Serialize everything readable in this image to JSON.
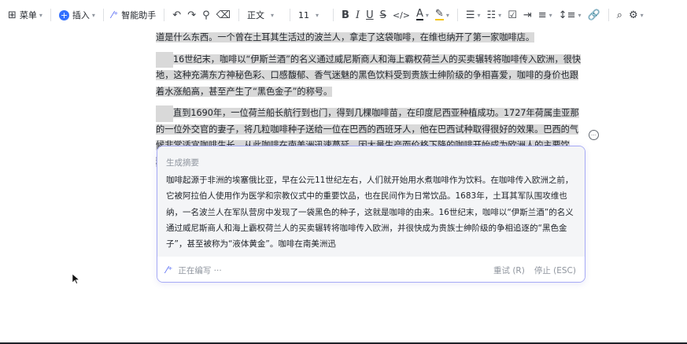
{
  "toolbar": {
    "menu_label": "菜单",
    "insert_label": "插入",
    "assistant_label": "智能助手",
    "style_label": "正文",
    "font_size": "11"
  },
  "doc": {
    "line0": "道是什么东西。一个曾在土耳其生活过的波兰人，拿走了这袋咖啡，在维也纳开了第一家咖啡店。",
    "para1": "16世纪末，咖啡以“伊斯兰酒”的名义通过威尼斯商人和海上霸权荷兰人的买卖辗转将咖啡传入欧洲，很快地，这种充满东方神秘色彩、口感馥郁、香气迷魅的黑色饮料受到贵族士绅阶级的争相喜爱，咖啡的身价也跟着水涨船高，甚至产生了“黑色金子”的称号。",
    "para2": "直到1690年，一位荷兰船长航行到也门，得到几棵咖啡苗，在印度尼西亚种植成功。1727年荷属圭亚那的一位外交官的妻子，将几粒咖啡种子送给一位在巴西的西班牙人，他在巴西试种取得很好的效果。巴西的气候非常适宜咖啡生长。从此咖啡在南美洲迅速蔓延。因大量生产而价格下降的咖啡开始成为欧洲人的主要饮料。"
  },
  "panel": {
    "title": "生成摘要",
    "text": "咖啡起源于非洲的埃塞俄比亚，早在公元11世纪左右，人们就开始用水煮咖啡作为饮料。在咖啡传入欧洲之前，它被阿拉伯人使用作为医学和宗教仪式中的重要饮品，也在民间作为日常饮品。1683年，土耳其军队围攻维也纳，一名波兰人在军队营房中发现了一袋黑色的种子，这就是咖啡的由来。16世纪末，咖啡以“伊斯兰酒”的名义通过威尼斯商人和海上霸权荷兰人的买卖辗转将咖啡传入欧洲，并很快成为贵族士绅阶级的争相追逐的“黑色金子”，甚至被称为“液体黄金”。咖啡在南美洲迅",
    "status": "正在编写 ···",
    "retry_label": "重试 (R)",
    "stop_label": "停止 (ESC)"
  },
  "colors": {
    "accent": "#5b6ef5",
    "highlight": "#d9d9d9",
    "panel_border": "#a5a9f5"
  }
}
